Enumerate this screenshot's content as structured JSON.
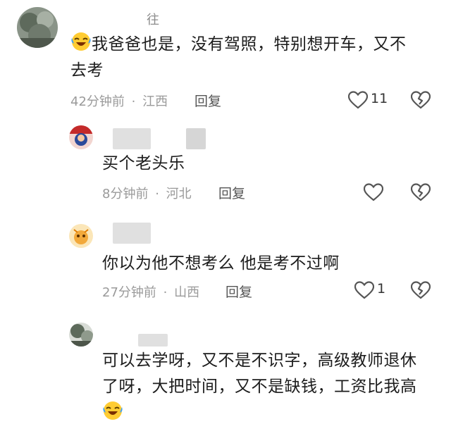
{
  "comments": [
    {
      "username": "往",
      "emoji_icon": "laughing-crying-emoji",
      "text_line1": "我爸爸也是，没有驾照，特别想开车，又不",
      "text_line2": "去考",
      "time": "42分钟前",
      "location": "江西",
      "separator": "·",
      "reply_label": "回复",
      "like_count": "11",
      "like_icon": "heart-outline-icon",
      "dislike_icon": "broken-heart-icon"
    },
    {
      "username": "",
      "text_line1": "买个老头乐",
      "time": "8分钟前",
      "location": "河北",
      "separator": "·",
      "reply_label": "回复",
      "like_count": "",
      "like_icon": "heart-outline-icon",
      "dislike_icon": "broken-heart-icon"
    },
    {
      "username": "",
      "text_line1": "你以为他不想考么 他是考不过啊",
      "time": "27分钟前",
      "location": "山西",
      "separator": "·",
      "reply_label": "回复",
      "like_count": "1",
      "like_icon": "heart-outline-icon",
      "dislike_icon": "broken-heart-icon"
    },
    {
      "username": "",
      "text_line1": "可以去学呀，又不是不识字，高级教师退休",
      "text_line2": "了呀，大把时间，又不是缺钱，工资比我高",
      "emoji_icon": "laughing-crying-emoji"
    }
  ],
  "colors": {
    "text": "#1c1c1c",
    "meta": "#9a9a9a",
    "icon": "#555555"
  }
}
